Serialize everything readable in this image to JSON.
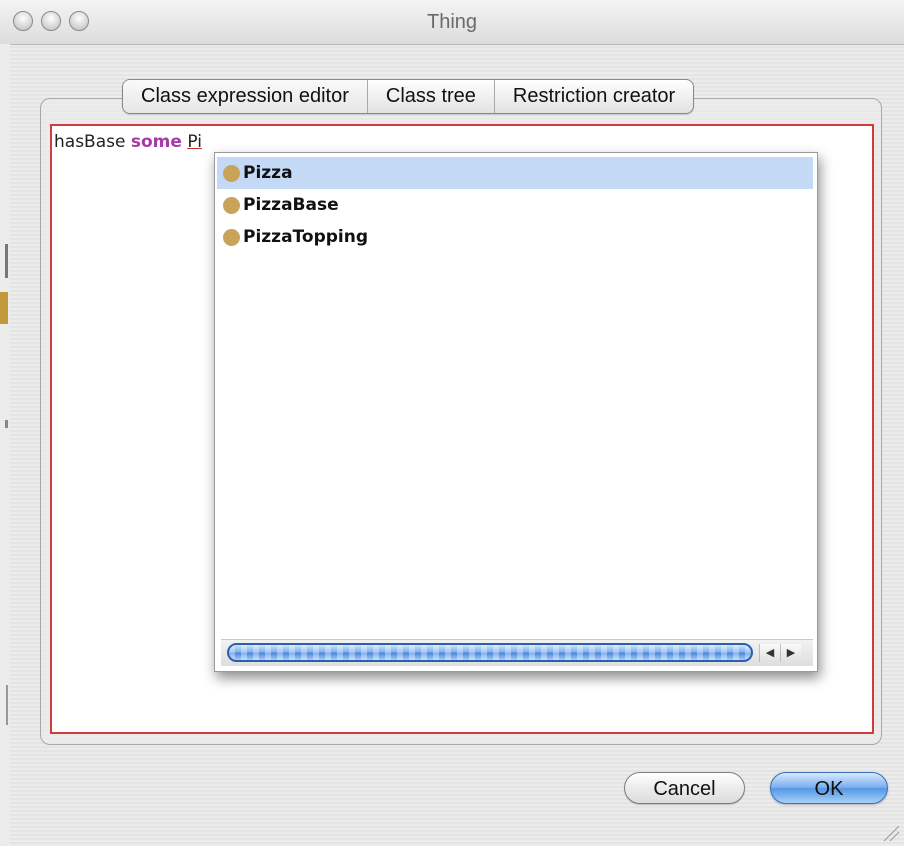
{
  "window": {
    "title": "Thing"
  },
  "tabs": [
    {
      "label": "Class expression editor",
      "selected": true
    },
    {
      "label": "Class tree",
      "selected": false
    },
    {
      "label": "Restriction creator",
      "selected": false
    }
  ],
  "editor": {
    "property": "hasBase",
    "keyword": "some",
    "typed": "Pi"
  },
  "autocomplete": {
    "items": [
      {
        "label": "Pizza",
        "selected": true
      },
      {
        "label": "PizzaBase",
        "selected": false
      },
      {
        "label": "PizzaTopping",
        "selected": false
      }
    ],
    "item_icon": "class-circle-icon"
  },
  "buttons": {
    "cancel": "Cancel",
    "ok": "OK"
  },
  "colors": {
    "keyword": "#a63aa6",
    "error_border": "#d33a3a",
    "selection": "#c4d9f6",
    "class_icon": "#caa35a",
    "default_button": "#5596e6"
  }
}
